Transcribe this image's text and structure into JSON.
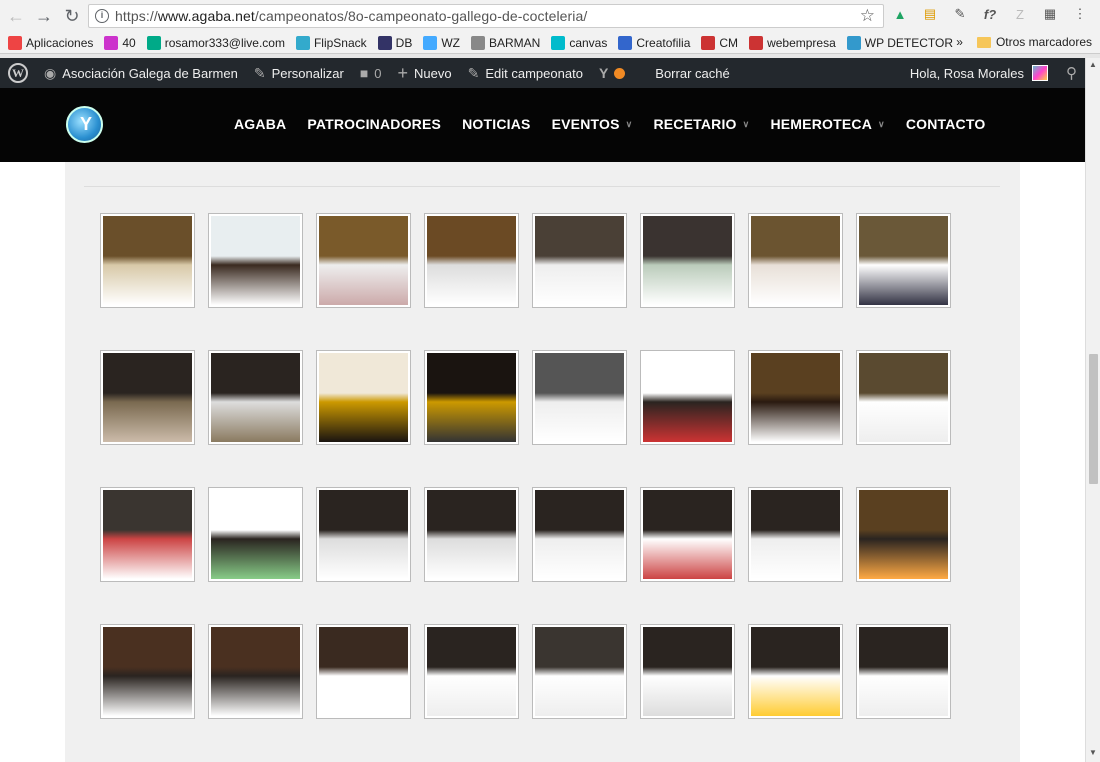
{
  "browser": {
    "url_prefix": "https://",
    "url_host": "www.agaba.net",
    "url_path": "/campeonatos/8o-campeonato-gallego-de-cocteleria/"
  },
  "bookmarks": {
    "items": [
      {
        "label": "Aplicaciones",
        "icon": "apps-grid-icon",
        "color": "#e44"
      },
      {
        "label": "40",
        "icon": "app-icon",
        "color": "#c3c"
      },
      {
        "label": "rosamor333@live.com",
        "icon": "windows-icon",
        "color": "#0a8"
      },
      {
        "label": "FlipSnack",
        "icon": "flipsnack-icon",
        "color": "#3ac"
      },
      {
        "label": "DB",
        "icon": "db-icon",
        "color": "#336"
      },
      {
        "label": "WZ",
        "icon": "wz-icon",
        "color": "#4af"
      },
      {
        "label": "BARMAN",
        "icon": "page-icon",
        "color": "#888"
      },
      {
        "label": "canvas",
        "icon": "canva-icon",
        "color": "#0bc"
      },
      {
        "label": "Creatofilia",
        "icon": "creatofilia-icon",
        "color": "#36c"
      },
      {
        "label": "CM",
        "icon": "cm-icon",
        "color": "#c33"
      },
      {
        "label": "webempresa",
        "icon": "webempresa-icon",
        "color": "#c33"
      },
      {
        "label": "WP DETECTOR",
        "icon": "wp-detector-icon",
        "color": "#39c"
      }
    ],
    "more": "»",
    "other": "Otros marcadores"
  },
  "wp_admin": {
    "site_name": "Asociación Galega de Barmen",
    "customize": "Personalizar",
    "comments_count": "0",
    "new": "Nuevo",
    "edit": "Edit campeonato",
    "cache": "Borrar caché",
    "greeting": "Hola, Rosa Morales"
  },
  "site_menu": {
    "items": [
      {
        "label": "AGABA",
        "dropdown": false
      },
      {
        "label": "PATROCINADORES",
        "dropdown": false
      },
      {
        "label": "NOTICIAS",
        "dropdown": false
      },
      {
        "label": "EVENTOS",
        "dropdown": true
      },
      {
        "label": "RECETARIO",
        "dropdown": true
      },
      {
        "label": "HEMEROTECA",
        "dropdown": true
      },
      {
        "label": "CONTACTO",
        "dropdown": false
      }
    ]
  },
  "gallery": {
    "rows": 4,
    "cols": 8,
    "photo_palettes": [
      [
        "#6a4f2a",
        "#d8c9a8",
        "#fff"
      ],
      [
        "#e8eef0",
        "#3a2a20",
        "#fff"
      ],
      [
        "#7a5a2a",
        "#eee",
        "#caa"
      ],
      [
        "#6b4a24",
        "#ddd",
        "#fff"
      ],
      [
        "#4a4036",
        "#eee",
        "#fff"
      ],
      [
        "#3a3330",
        "#bcb",
        "#fff"
      ],
      [
        "#6b5430",
        "#e8e0d8",
        "#fff"
      ],
      [
        "#6a5838",
        "#fff",
        "#334"
      ],
      [
        "#2a2420",
        "#7a6a50",
        "#cba"
      ],
      [
        "#2a2420",
        "#ddd",
        "#8a7a60"
      ],
      [
        "#f0e8d8",
        "#c90",
        "#1a1410"
      ],
      [
        "#1a1410",
        "#c90",
        "#333"
      ],
      [
        "#555",
        "#eee",
        "#fff"
      ],
      [
        "#fff",
        "#2a2420",
        "#c33"
      ],
      [
        "#5a4020",
        "#2a1a10",
        "#fff"
      ],
      [
        "#5a4a30",
        "#fff",
        "#eee"
      ],
      [
        "#3a3530",
        "#c44",
        "#fff"
      ],
      [
        "#fff",
        "#2a2420",
        "#8c8"
      ],
      [
        "#2a2420",
        "#ddd",
        "#fff"
      ],
      [
        "#2a2420",
        "#ddd",
        "#fff"
      ],
      [
        "#2a2420",
        "#eee",
        "#fff"
      ],
      [
        "#2a2420",
        "#fff",
        "#c44"
      ],
      [
        "#2a2420",
        "#eee",
        "#fff"
      ],
      [
        "#5a4020",
        "#2a2420",
        "#fa4"
      ],
      [
        "#4a3020",
        "#2a2420",
        "#fff"
      ],
      [
        "#4a3020",
        "#2a2420",
        "#fff"
      ],
      [
        "#3a2a20",
        "#fff",
        "#fff"
      ],
      [
        "#2a2420",
        "#fff",
        "#eee"
      ],
      [
        "#3a3530",
        "#fff",
        "#eee"
      ],
      [
        "#2a2420",
        "#fff",
        "#ddd"
      ],
      [
        "#2a2420",
        "#fff",
        "#fc3"
      ],
      [
        "#2a2420",
        "#fff",
        "#eee"
      ]
    ]
  }
}
